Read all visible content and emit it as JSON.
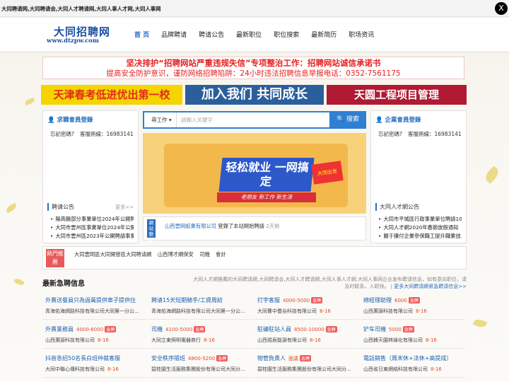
{
  "top_bar": {
    "title": "大同聘请网,大同聘请会,大同人才聘请网,大同人事人才网,大同人事网",
    "close_label": "X"
  },
  "header": {
    "logo_cn": "大同招聘网",
    "logo_url": "www.dtzpw.com"
  },
  "nav": [
    "首 页",
    "品牌聘请",
    "聘请公告",
    "最新职位",
    "职位搜索",
    "最新简历",
    "职场资讯"
  ],
  "banner": {
    "line1": "坚决排护“招聘网站严重违规失信”专项整治工作：招聘网站诚信承诺书",
    "line2": "提高安全防护意识，谨防网络招聘陷阱：24小时违法招聘信息举报电话：0352-7561175"
  },
  "ads": [
    "天津春考低进优出第一校",
    "加入我们 共同成长",
    "天圆工程项目管理"
  ],
  "left_panel": {
    "title": "求職會員登錄",
    "forgot": "忘記密碼?",
    "service": "客服熱線：16983141",
    "section_title": "聘请公告",
    "more": "更多>>",
    "news": [
      "陽高縣部分事業單位2024年公開聘...",
      "大同市雲州區事業單位2024年公開...",
      "大同市雲州區2023年公開聘請事業..."
    ]
  },
  "right_panel": {
    "title": "企業會員登錄",
    "forgot": "忘記密碼?",
    "service": "客服熱線：16983141",
    "section_title": "大同人才網公告",
    "news": [
      "大同市平城區行政事業單位聘請10...",
      "大同人才網2020年春節放假通知",
      "關于擡付企業參保職工提升職業技..."
    ]
  },
  "search": {
    "select": "尋工作",
    "placeholder": "請輸入关鍵字",
    "button": "搜索"
  },
  "promo": {
    "headline": "轻松就业 一网搞定",
    "sub": "老朋友  新工作  新生活",
    "flag": "大同出发"
  },
  "dynamics": {
    "tag": "網站動態",
    "company": "山西雲网紙業有限公司",
    "action": "登錄了本站開始聘請",
    "time": "2天前"
  },
  "hot": {
    "label": "熱門推薦",
    "links": [
      "大同雲岡區大同開發區大同聘请網",
      "山西博才網保安",
      "司機",
      "會計"
    ]
  },
  "latest": {
    "title": "最新急聘信息",
    "desc": "大同人才網推薦的大同聘请網,大同聘请会,大同人才聘请網,大同人事人才網,大同人事网企业发布聘请信息，如有意向职位，请及时联系，入职快。",
    "more": "更多大同聘请網紧急聘请信息>>"
  },
  "jobs": [
    {
      "title": "外賣送餐員只為過萬提供車子提供住",
      "salary": "",
      "urgent": false,
      "company": "青海佑海網路科技有限公司大同第一分公...",
      "num": ""
    },
    {
      "title": "聘请15天短期騎手/工資周結",
      "salary": "",
      "urgent": false,
      "company": "青海佑海網路科技有限公司大同第一分公...",
      "num": ""
    },
    {
      "title": "打字客服",
      "salary": "4000-5000",
      "urgent": true,
      "company": "大同曹中豐谷科技有限公司",
      "num": "8-16"
    },
    {
      "title": "總經理助理",
      "salary": "6000",
      "urgent": true,
      "company": "山西灝源科技有限公司",
      "num": "8-16"
    },
    {
      "title": "外賣業務員",
      "salary": "4000-6000",
      "urgent": true,
      "company": "山西灝源科技有限公司",
      "num": "8-16"
    },
    {
      "title": "司機",
      "salary": "4100-5000",
      "urgent": true,
      "company": "大同立東照明電器商行",
      "num": "8-16"
    },
    {
      "title": "駐礦駐站人員",
      "salary": "8500-10000",
      "urgent": true,
      "company": "山西煜辰能源有限公司",
      "num": "8-16"
    },
    {
      "title": "铲车司機",
      "salary": "5000",
      "urgent": true,
      "company": "山西鋒天園林綠化有限公司",
      "num": "8-16"
    },
    {
      "title": "抖音急招50名長白班仲裁客服",
      "salary": "",
      "urgent": false,
      "company": "大同中聯心傳科技有限公司",
      "num": "8-16"
    },
    {
      "title": "安全秩序隨班",
      "salary": "4800-5200",
      "urgent": true,
      "company": "碧桂園生活服務集團股份有限公司大同分...",
      "num": ""
    },
    {
      "title": "物管負責人",
      "salary": "面議",
      "urgent": true,
      "company": "碧桂園生活服務集團股份有限公司大同分...",
      "num": ""
    },
    {
      "title": "電話銷售（周末休+法休+高提成）",
      "salary": "",
      "urgent": false,
      "company": "山西省日東網絡科技有限公司",
      "num": "8-16"
    }
  ],
  "colors": {
    "accent": "#2f7fd3",
    "red": "#e52121",
    "hot": "#e85a5a"
  }
}
